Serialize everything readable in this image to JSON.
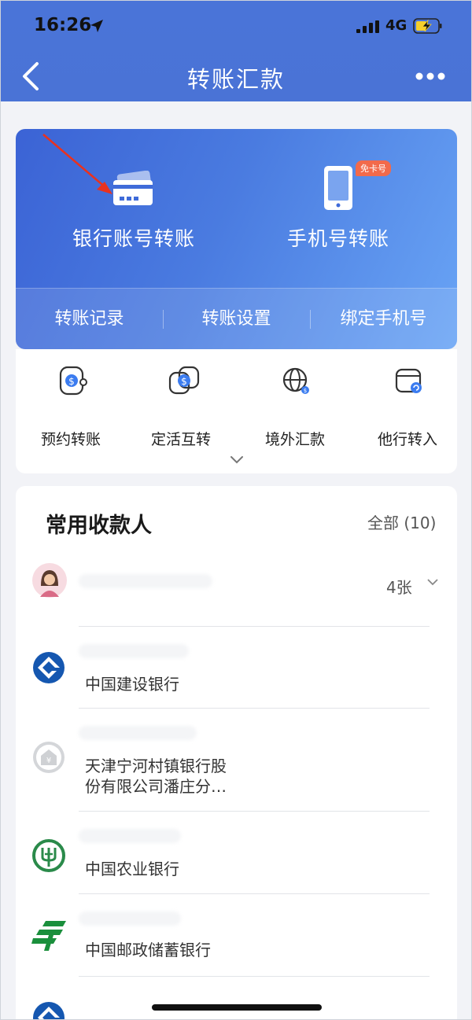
{
  "status_bar": {
    "time": "16:26",
    "network": "4G"
  },
  "nav": {
    "title": "转账汇款"
  },
  "transfer_card": {
    "bank_account_transfer": "银行账号转账",
    "phone_transfer": "手机号转账",
    "phone_badge": "免卡号",
    "links": [
      "转账记录",
      "转账设置",
      "绑定手机号"
    ]
  },
  "quick_actions": [
    "预约转账",
    "定活互转",
    "境外汇款",
    "他行转入"
  ],
  "payees": {
    "title": "常用收款人",
    "all_label": "全部 (10)",
    "first_cards": "4张",
    "banks": [
      {
        "name": "中国建设银行",
        "icon": "ccb-logo-icon"
      },
      {
        "name_line1": "天津宁河村镇银行股",
        "name_line2": "份有限公司潘庄分…",
        "icon": "generic-bank-icon"
      },
      {
        "name": "中国农业银行",
        "icon": "abc-logo-icon"
      },
      {
        "name": "中国邮政储蓄银行",
        "icon": "psbc-logo-icon"
      }
    ]
  },
  "colors": {
    "primary": "#4a74d8",
    "card_gradient_end": "#69a4f5",
    "badge": "#f26a4b",
    "ccb": "#1557b0",
    "abc": "#2a8a4a",
    "psbc": "#1a8f3c"
  }
}
